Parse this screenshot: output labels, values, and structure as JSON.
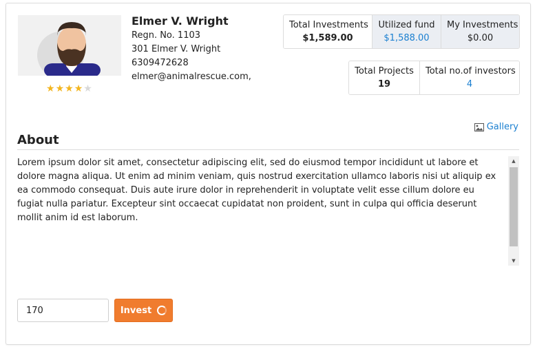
{
  "profile": {
    "name": "Elmer V. Wright",
    "regn": "Regn. No. 1103",
    "address": "301 Elmer V. Wright",
    "phone": "6309472628",
    "email": "elmer@animalrescue.com,",
    "rating": 4,
    "rating_max": 5
  },
  "stats": {
    "total_investments": {
      "label": "Total Investments",
      "value": "$1,589.00"
    },
    "utilized_fund": {
      "label": "Utilized fund",
      "value": "$1,588.00"
    },
    "my_investments": {
      "label": "My Investments",
      "value": "$0.00"
    },
    "total_projects": {
      "label": "Total Projects",
      "value": "19"
    },
    "total_investors": {
      "label": "Total no.of investors",
      "value": "4"
    }
  },
  "gallery": {
    "label": "Gallery",
    "icon": "image-icon"
  },
  "about": {
    "title": "About",
    "text": "Lorem ipsum dolor sit amet, consectetur adipiscing elit, sed do eiusmod tempor incididunt ut labore et dolore magna aliqua. Ut enim ad minim veniam, quis nostrud exercitation ullamco laboris nisi ut aliquip ex ea commodo consequat. Duis aute irure dolor in reprehenderit in voluptate velit esse cillum dolore eu fugiat nulla pariatur. Excepteur sint occaecat cupidatat non proident, sunt in culpa qui officia deserunt mollit anim id est laborum."
  },
  "invest": {
    "amount": "170",
    "button_label": "Invest",
    "button_color": "#f07c2e"
  },
  "colors": {
    "link": "#1a7fd0",
    "star": "#f3b51e",
    "shade": "#ebeef3"
  }
}
